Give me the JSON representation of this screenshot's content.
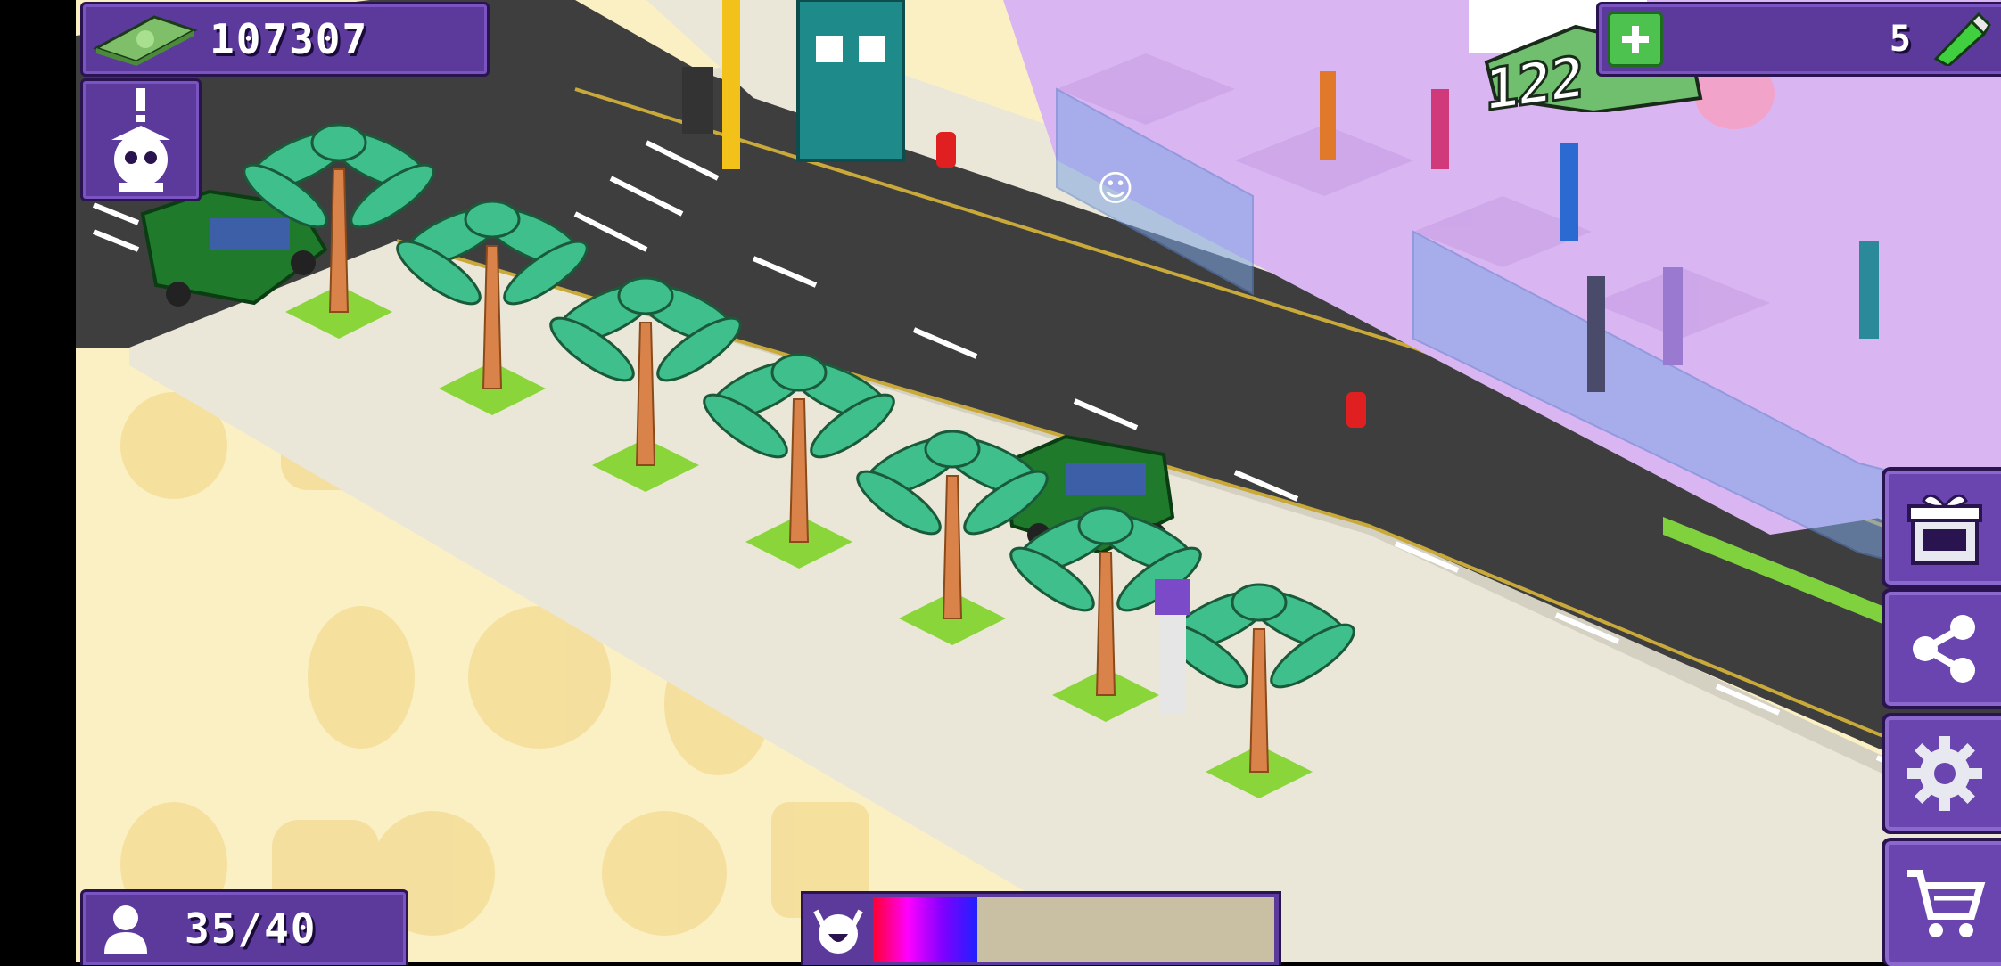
{
  "hud": {
    "money": "107307",
    "vip_count": "5",
    "population": "35/40",
    "happiness_fraction": 0.26,
    "happiness_colors": [
      "#ff0030",
      "#ff00ff",
      "#8000ff",
      "#2020ff"
    ]
  },
  "scene": {
    "floating_value": "122",
    "palm_tree_count": 7,
    "cars": [
      "green-van",
      "green-car"
    ]
  },
  "icons": {
    "money": "cash-stack-icon",
    "alert": "alert-guest-icon",
    "add": "plus-icon",
    "vip": "battery-icon",
    "population": "person-icon",
    "happiness": "happy-face-icon",
    "gift": "gift-box-icon",
    "share": "share-icon",
    "settings": "gear-icon",
    "shop": "shopping-cart-icon"
  },
  "colors": {
    "hud_panel": "#5b3a9c",
    "road": "#3e3e3e",
    "sidewalk": "#e6e2d4",
    "floor": "#d9b6f2",
    "palm_leaf": "#3fbf8c",
    "car": "#1f7a2c"
  }
}
